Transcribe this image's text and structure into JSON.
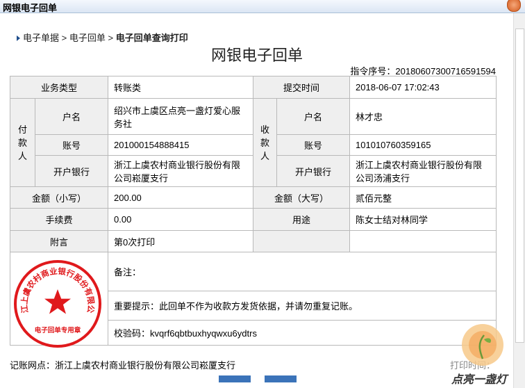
{
  "window": {
    "title": "网银电子回单"
  },
  "breadcrumb": {
    "item1": "电子单据",
    "sep": ">",
    "item2": "电子回单",
    "current": "电子回单查询打印"
  },
  "doc": {
    "title": "网银电子回单",
    "serial_label": "指令序号：",
    "serial_value": "20180607300716591594"
  },
  "receipt": {
    "biz_type_label": "业务类型",
    "biz_type_value": "转账类",
    "submit_time_label": "提交时间",
    "submit_time_value": "2018-06-07 17:02:43",
    "payer_label": "付款人",
    "payee_label": "收款人",
    "payer": {
      "name_label": "户名",
      "name_value": "绍兴市上虞区点亮一盏灯爱心服务社",
      "account_label": "账号",
      "account_value": "201000154888415",
      "bank_label": "开户银行",
      "bank_value": "浙江上虞农村商业银行股份有限公司崧厦支行"
    },
    "payee": {
      "name_label": "户名",
      "name_value": "林才忠",
      "account_label": "账号",
      "account_value": "101010760359165",
      "bank_label": "开户银行",
      "bank_value": "浙江上虞农村商业银行股份有限公司汤浦支行"
    },
    "amount_lower_label": "金额（小写）",
    "amount_lower_value": "200.00",
    "amount_upper_label": "金额（大写）",
    "amount_upper_value": "贰佰元整",
    "fee_label": "手续费",
    "fee_value": "0.00",
    "purpose_label": "用途",
    "purpose_value": "陈女士结对林同学",
    "postscript_label": "附言",
    "postscript_value": "第0次打印",
    "remark_label": "备注：",
    "notice": "重要提示：此回单不作为收款方发货依据，并请勿重复记账。",
    "verify_label": "校验码：",
    "verify_value": "kvqrf6qbtbuxhyqwxu6ydtrs"
  },
  "seal": {
    "ring_text": "浙江上虞农村商业银行股份有限公司",
    "center_text": "电子回单专用章",
    "color": "#e0191c"
  },
  "footer": {
    "branch_label": "记账网点：",
    "branch_value": "浙江上虞农村商业银行股份有限公司崧厦支行",
    "print_time_label": "打印时间："
  },
  "watermark": {
    "text": "点亮一盏灯"
  }
}
